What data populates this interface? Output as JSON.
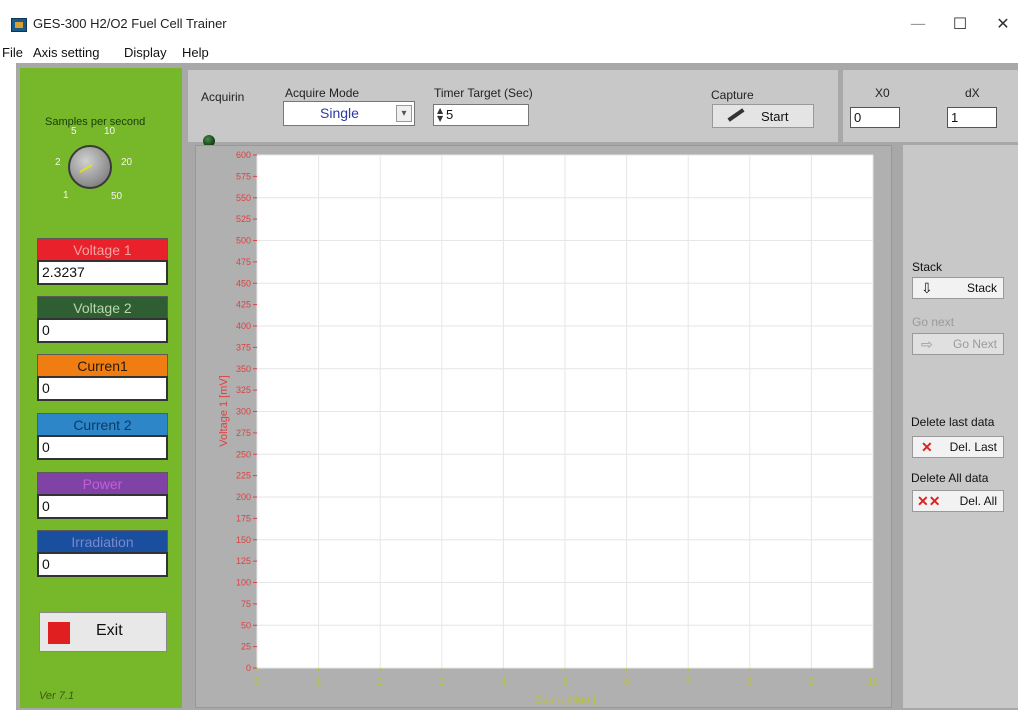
{
  "window": {
    "title": "GES-300 H2/O2 Fuel Cell Trainer",
    "minimize": "—",
    "maximize": "☐",
    "close": "✕"
  },
  "menu": [
    "File",
    "Axis setting",
    "Display",
    "Help"
  ],
  "left": {
    "knob_label": "Samples per second",
    "knob_ticks": [
      "5",
      "10",
      "2",
      "20",
      "1",
      "50"
    ],
    "readouts": [
      {
        "label": "Voltage 1",
        "value": "2.3237",
        "color": "#e8212b",
        "text_color": "#f7a0a0"
      },
      {
        "label": "Voltage 2",
        "value": "0",
        "color": "#2f5e32",
        "text_color": "#b8d8a8"
      },
      {
        "label": "Curren1",
        "value": "0",
        "color": "#f07d12",
        "text_color": "#2a1a05"
      },
      {
        "label": "Current 2",
        "value": "0",
        "color": "#2d86c8",
        "text_color": "#0b3a66"
      },
      {
        "label": "Power",
        "value": "0",
        "color": "#8042a4",
        "text_color": "#c060d8"
      },
      {
        "label": "Irradiation",
        "value": "0",
        "color": "#1a4fa0",
        "text_color": "#7a88c8"
      }
    ],
    "exit_label": "Exit",
    "version": "Ver 7.1"
  },
  "top": {
    "acquiring_label": "Acquirin",
    "mode_label": "Acquire Mode",
    "mode_value": "Single",
    "timer_label": "Timer Target (Sec)",
    "timer_value": "5",
    "capture_label": "Capture",
    "capture_button": "Start",
    "x0_label": "X0",
    "x0_value": "0",
    "dx_label": "dX",
    "dx_value": "1"
  },
  "right": {
    "stack_label": "Stack",
    "stack_button": "Stack",
    "next_label": "Go next",
    "next_button": "Go Next",
    "del_last_label": "Delete last data",
    "del_last_button": "Del. Last",
    "del_all_label": "Delete All data",
    "del_all_button": "Del. All"
  },
  "chart_data": {
    "type": "line",
    "xlabel": "Count [Num]",
    "ylabel": "Voltage 1 [mV]",
    "xlim": [
      0,
      10
    ],
    "ylim": [
      0,
      600
    ],
    "x_ticks": [
      0,
      1,
      2,
      3,
      4,
      5,
      6,
      7,
      8,
      9,
      10
    ],
    "y_ticks": [
      0,
      25,
      50,
      75,
      100,
      125,
      150,
      175,
      200,
      225,
      250,
      275,
      300,
      325,
      350,
      375,
      400,
      425,
      450,
      475,
      500,
      525,
      550,
      575,
      600
    ],
    "grid": true,
    "series": [],
    "colors": {
      "axis_y": "#e04040",
      "axis_x": "#b8c040",
      "grid": "#e6e6e6"
    }
  }
}
